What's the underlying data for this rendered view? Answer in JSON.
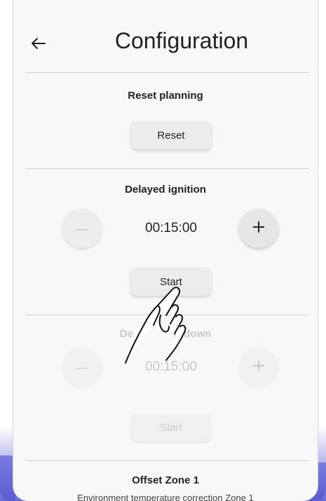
{
  "header": {
    "back_icon": "back-arrow-icon",
    "title": "Configuration"
  },
  "reset_planning": {
    "title": "Reset planning",
    "button_label": "Reset"
  },
  "delayed_ignition": {
    "title": "Delayed ignition",
    "time": "00:15:00",
    "minus_icon": "minus-icon",
    "plus_icon": "plus-icon",
    "button_label": "Start"
  },
  "delayed_shutdown": {
    "title_left": "De",
    "title_right": "utdown",
    "time": "00:15:00",
    "minus_icon": "minus-icon",
    "plus_icon": "plus-icon",
    "button_label": "Start"
  },
  "offset_zone": {
    "title": "Offset Zone 1",
    "subtitle": "Environment temperature correction Zone 1"
  },
  "overlay": {
    "icon": "tap-hand-icon"
  },
  "colors": {
    "accent": "#6a6ad8",
    "background": "#f8f8f8",
    "disabled": "#c8c8c8"
  }
}
